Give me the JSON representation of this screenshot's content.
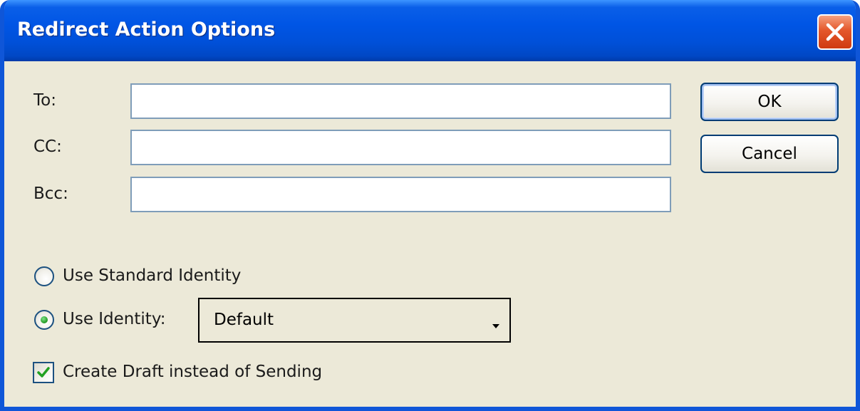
{
  "window": {
    "title": "Redirect Action Options"
  },
  "fields": {
    "to_label": "To:",
    "to_value": "",
    "cc_label": "CC:",
    "cc_value": "",
    "bcc_label": "Bcc:",
    "bcc_value": ""
  },
  "buttons": {
    "ok_label": "OK",
    "cancel_label": "Cancel"
  },
  "identity": {
    "standard_label": "Use Standard Identity",
    "standard_selected": false,
    "custom_label": "Use Identity:",
    "custom_selected": true,
    "selected_value": "Default"
  },
  "options": {
    "draft_label": "Create Draft instead of Sending",
    "draft_checked": true
  },
  "icons": {
    "close": "close-icon",
    "dropdown": "chevron-down-icon",
    "check": "checkmark-icon"
  },
  "colors": {
    "titlebar": "#0055e5",
    "dialog_bg": "#ece9d8",
    "close_button": "#e4572b",
    "radio_dot": "#2ca22d",
    "checkmark": "#21a121",
    "field_border": "#7f9db9"
  }
}
